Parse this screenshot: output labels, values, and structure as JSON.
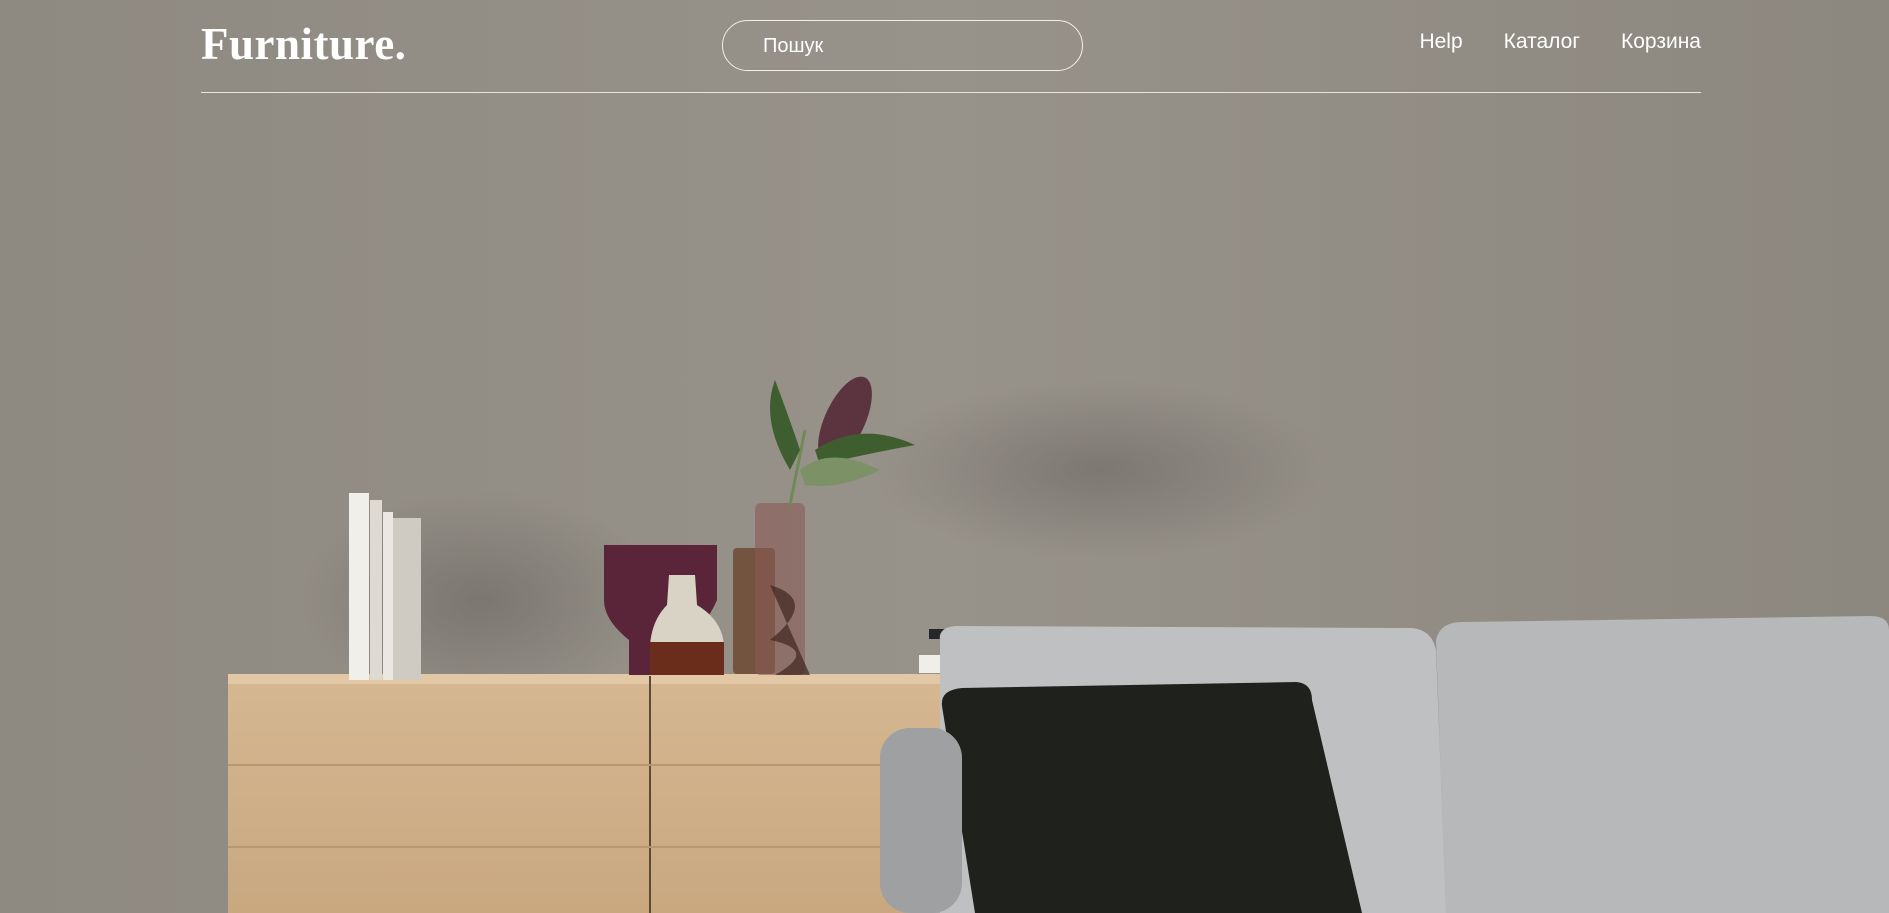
{
  "header": {
    "logo": "Furniture.",
    "search": {
      "placeholder": "Пошук",
      "value": ""
    },
    "nav": [
      {
        "label": "Help"
      },
      {
        "label": "Каталог"
      },
      {
        "label": "Корзина"
      }
    ]
  },
  "colors": {
    "wall": "#8f8a82",
    "header_text": "#ffffff",
    "divider": "#e9e6e1"
  }
}
